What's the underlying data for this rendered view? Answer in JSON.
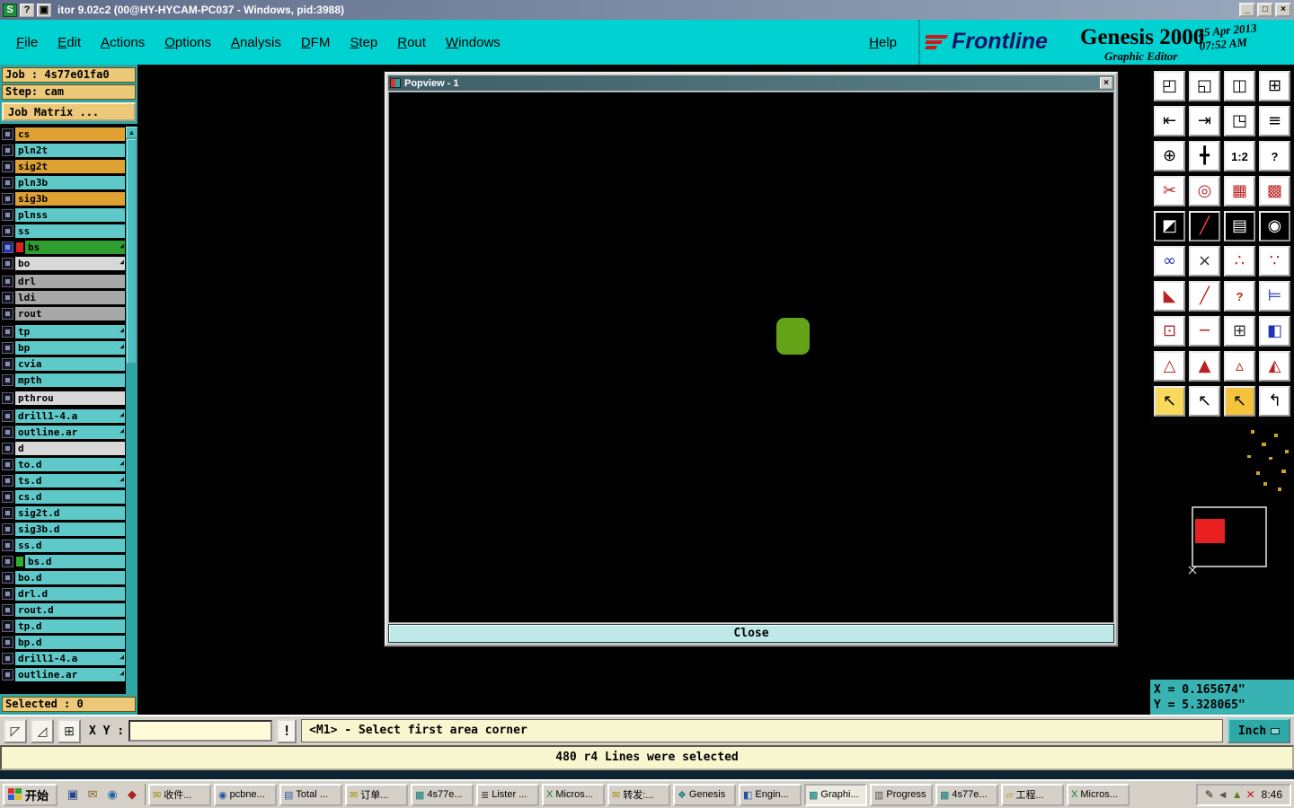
{
  "window": {
    "title": "itor 9.02c2 (00@HY-HYCAM-PC037 - Windows, pid:3988)",
    "logo_glyph": "S",
    "help_glyph": "?",
    "extra_glyph": "▣",
    "minimize_glyph": "_",
    "maximize_glyph": "□",
    "close_glyph": "×"
  },
  "menubar": {
    "items": [
      "File",
      "Edit",
      "Actions",
      "Options",
      "Analysis",
      "DFM",
      "Step",
      "Rout",
      "Windows"
    ],
    "help": "Help"
  },
  "brand": {
    "frontline": "Frontline",
    "product": "Genesis 2000",
    "date": "25 Apr 2013",
    "time": "07:52 AM",
    "subtitle": "Graphic Editor"
  },
  "sidebar": {
    "job_label": "Job : 4s77e01fa0",
    "step_label": "Step: cam",
    "matrix_button": "Job Matrix ...",
    "selected_label": "Selected : 0",
    "marker_glyph": "◢",
    "scroll_up_glyph": "▲",
    "colors": {
      "orange": "#dfa232",
      "cyan": "#5fc9c9",
      "green": "#2f9e2f",
      "gray": "#a8a8a8",
      "light": "#d8d8d8"
    },
    "layers": [
      {
        "name": "cs",
        "color": "#dfa232"
      },
      {
        "name": "pln2t",
        "color": "#5fc9c9"
      },
      {
        "name": "sig2t",
        "color": "#dfa232"
      },
      {
        "name": "pln3b",
        "color": "#5fc9c9"
      },
      {
        "name": "sig3b",
        "color": "#dfa232"
      },
      {
        "name": "plnss",
        "color": "#5fc9c9"
      },
      {
        "name": "ss",
        "color": "#5fc9c9"
      },
      {
        "name": "bs",
        "color": "#2f9e2f",
        "checkbox": "#2233bb",
        "swatch": "#dd2222",
        "marker": true
      },
      {
        "name": "bo",
        "color": "#d8d8d8",
        "marker": true
      },
      {
        "name": "drl",
        "color": "#a8a8a8",
        "gap": true
      },
      {
        "name": "ldi",
        "color": "#a8a8a8"
      },
      {
        "name": "rout",
        "color": "#a8a8a8"
      },
      {
        "name": "tp",
        "color": "#5fc9c9",
        "marker": true,
        "gap": true
      },
      {
        "name": "bp",
        "color": "#5fc9c9",
        "marker": true
      },
      {
        "name": "cvia",
        "color": "#5fc9c9"
      },
      {
        "name": "mpth",
        "color": "#5fc9c9"
      },
      {
        "name": "pthrou",
        "color": "#d8d8d8",
        "gap": true
      },
      {
        "name": "drill1-4.a",
        "color": "#5fc9c9",
        "marker": true,
        "gap": true
      },
      {
        "name": "outline.ar",
        "color": "#5fc9c9",
        "marker": true
      },
      {
        "name": "d",
        "color": "#d8d8d8"
      },
      {
        "name": "to.d",
        "color": "#5fc9c9",
        "marker": true
      },
      {
        "name": "ts.d",
        "color": "#5fc9c9",
        "marker": true
      },
      {
        "name": "cs.d",
        "color": "#5fc9c9"
      },
      {
        "name": "sig2t.d",
        "color": "#5fc9c9"
      },
      {
        "name": "sig3b.d",
        "color": "#5fc9c9"
      },
      {
        "name": "ss.d",
        "color": "#5fc9c9"
      },
      {
        "name": "bs.d",
        "color": "#5fc9c9",
        "swatch": "#2fae2f"
      },
      {
        "name": "bo.d",
        "color": "#5fc9c9"
      },
      {
        "name": "drl.d",
        "color": "#5fc9c9"
      },
      {
        "name": "rout.d",
        "color": "#5fc9c9"
      },
      {
        "name": "tp.d",
        "color": "#5fc9c9"
      },
      {
        "name": "bp.d",
        "color": "#5fc9c9"
      },
      {
        "name": "drill1-4.a",
        "color": "#5fc9c9",
        "marker": true
      },
      {
        "name": "outline.ar",
        "color": "#5fc9c9",
        "marker": true
      }
    ]
  },
  "popview": {
    "title": "Popview - 1",
    "close_button": "Close",
    "close_glyph": "×",
    "pad_color": "#64a318"
  },
  "tools": [
    {
      "name": "fit-screen-tool",
      "glyph": "◰",
      "bg": "#ffffff",
      "fg": "#000000"
    },
    {
      "name": "redraw-screen-tool",
      "glyph": "◱",
      "bg": "#ffffff",
      "fg": "#000000"
    },
    {
      "name": "dual-view-tool",
      "glyph": "◫",
      "bg": "#ffffff",
      "fg": "#000000"
    },
    {
      "name": "quad-view-tool",
      "glyph": "⊞",
      "bg": "#ffffff",
      "fg": "#000000"
    },
    {
      "name": "pan-left-tool",
      "glyph": "⇤",
      "bg": "#ffffff",
      "fg": "#000000"
    },
    {
      "name": "pan-right-tool",
      "glyph": "⇥",
      "bg": "#ffffff",
      "fg": "#000000"
    },
    {
      "name": "previous-view-tool",
      "glyph": "◳",
      "bg": "#ffffff",
      "fg": "#000000"
    },
    {
      "name": "layer-stack-tool",
      "glyph": "≡",
      "bg": "#ffffff",
      "fg": "#000000"
    },
    {
      "name": "zoom-center-tool",
      "glyph": "⊕",
      "bg": "#ffffff",
      "fg": "#000000"
    },
    {
      "name": "pan-tool",
      "glyph": "╋",
      "bg": "#ffffff",
      "fg": "#000000"
    },
    {
      "name": "zoom-ratio-tool",
      "glyph": "1:2",
      "bg": "#ffffff",
      "fg": "#000000",
      "text": true
    },
    {
      "name": "help-tool",
      "glyph": "?",
      "bg": "#ffffff",
      "fg": "#000000",
      "text": true
    },
    {
      "name": "copy-view-tool",
      "glyph": "✂",
      "bg": "#ffffff",
      "fg": "#bb2222"
    },
    {
      "name": "probe-tool",
      "glyph": "◎",
      "bg": "#ffffff",
      "fg": "#bb2222"
    },
    {
      "name": "grid-snap-tool",
      "glyph": "▦",
      "bg": "#ffffff",
      "fg": "#bb2222"
    },
    {
      "name": "dot-grid-tool",
      "glyph": "▩",
      "bg": "#ffffff",
      "fg": "#bb2222"
    },
    {
      "name": "origin-tool",
      "glyph": "◩",
      "bg": "#000000",
      "fg": "#ffffff"
    },
    {
      "name": "diagonal-measure-tool",
      "glyph": "╱",
      "bg": "#000000",
      "fg": "#ff4444"
    },
    {
      "name": "ruler-tool",
      "glyph": "▤",
      "bg": "#000000",
      "fg": "#ffffff"
    },
    {
      "name": "center-mark-tool",
      "glyph": "◉",
      "bg": "#000000",
      "fg": "#ffffff"
    },
    {
      "name": "connect-points-tool",
      "glyph": "∞",
      "bg": "#ffffff",
      "fg": "#2233bb"
    },
    {
      "name": "close-pair-tool",
      "glyph": "×",
      "bg": "#ffffff",
      "fg": "#333333"
    },
    {
      "name": "measure-pair-tool",
      "glyph": "∴",
      "bg": "#ffffff",
      "fg": "#bb2222"
    },
    {
      "name": "measure-pad-tool",
      "glyph": "∵",
      "bg": "#ffffff",
      "fg": "#bb2222"
    },
    {
      "name": "angle-measure-tool",
      "glyph": "◣",
      "bg": "#ffffff",
      "fg": "#bb2222"
    },
    {
      "name": "slope-measure-tool",
      "glyph": "╱",
      "bg": "#ffffff",
      "fg": "#bb2222"
    },
    {
      "name": "query-tool",
      "glyph": "?",
      "bg": "#ffffff",
      "fg": "#bb2222",
      "text": true
    },
    {
      "name": "net-compare-tool",
      "glyph": "⊨",
      "bg": "#ffffff",
      "fg": "#2233bb"
    },
    {
      "name": "pad-mark-tool",
      "glyph": "⊡",
      "bg": "#ffffff",
      "fg": "#bb2222"
    },
    {
      "name": "line-mark-tool",
      "glyph": "─",
      "bg": "#ffffff",
      "fg": "#bb2222"
    },
    {
      "name": "frame-snap-tool",
      "glyph": "⊞",
      "bg": "#ffffff",
      "fg": "#333333"
    },
    {
      "name": "fill-area-tool",
      "glyph": "◧",
      "bg": "#ffffff",
      "fg": "#2233bb"
    },
    {
      "name": "triangle-open-tool",
      "glyph": "△",
      "bg": "#ffffff",
      "fg": "#bb2222"
    },
    {
      "name": "triangle-filled-tool",
      "glyph": "▲",
      "bg": "#ffffff",
      "fg": "#bb2222"
    },
    {
      "name": "triangle-small-tool",
      "glyph": "▵",
      "bg": "#ffffff",
      "fg": "#bb2222"
    },
    {
      "name": "triangle-mixed-tool",
      "glyph": "◭",
      "bg": "#ffffff",
      "fg": "#bb2222"
    },
    {
      "name": "select-cursor-tool",
      "glyph": "↖",
      "bg": "#f7d95c",
      "fg": "#000000"
    },
    {
      "name": "select-window-tool",
      "glyph": "↖",
      "bg": "#ffffff",
      "fg": "#000000"
    },
    {
      "name": "select-yellow-tool",
      "glyph": "↖",
      "bg": "#f5c23c",
      "fg": "#000000"
    },
    {
      "name": "select-route-tool",
      "glyph": "↰",
      "bg": "#ffffff",
      "fg": "#000000"
    }
  ],
  "statusbar": {
    "buttons": [
      {
        "name": "area-select-button",
        "glyph": "◸"
      },
      {
        "name": "area-select-alt-button",
        "glyph": "◿"
      },
      {
        "name": "grid-button",
        "glyph": "⊞"
      }
    ],
    "xy_label": "X Y :",
    "xy_value": "",
    "alert_button": "!",
    "message": "<M1> - Select first area corner",
    "units_button": "Inch"
  },
  "noticebar": {
    "message": "480 r4 Lines were selected"
  },
  "coords": {
    "x": "X = 0.165674\"",
    "y": "Y = 5.328065\""
  },
  "taskbar": {
    "start_label": "开始",
    "quick_launch": [
      {
        "name": "desktop-icon",
        "glyph": "▣",
        "color": "#224488"
      },
      {
        "name": "mail-icon",
        "glyph": "✉",
        "color": "#886622"
      },
      {
        "name": "browser-icon",
        "glyph": "◉",
        "color": "#2266aa"
      },
      {
        "name": "media-icon",
        "glyph": "◆",
        "color": "#aa2222"
      }
    ],
    "items": [
      {
        "label": "收件...",
        "icon": "mail-icon",
        "glyph": "✉",
        "color": "#aa8800"
      },
      {
        "label": "pcbne...",
        "icon": "app-icon",
        "glyph": "◉",
        "color": "#2255aa"
      },
      {
        "label": "Total ...",
        "icon": "disk-icon",
        "glyph": "▤",
        "color": "#3355aa"
      },
      {
        "label": "订单...",
        "icon": "mail-icon",
        "glyph": "✉",
        "color": "#aa8800"
      },
      {
        "label": "4s77e...",
        "icon": "editor-icon",
        "glyph": "▦",
        "color": "#117777"
      },
      {
        "label": "Lister ...",
        "icon": "list-icon",
        "glyph": "≣",
        "color": "#444444"
      },
      {
        "label": "Micros...",
        "icon": "excel-icon",
        "glyph": "X",
        "color": "#117733"
      },
      {
        "label": "转发:...",
        "icon": "mail-icon",
        "glyph": "✉",
        "color": "#aa8800"
      },
      {
        "label": "Genesis",
        "icon": "genesis-icon",
        "glyph": "❖",
        "color": "#0b7a7a"
      },
      {
        "label": "Engin...",
        "icon": "app-icon",
        "glyph": "◧",
        "color": "#2255aa"
      },
      {
        "label": "Graphi...",
        "icon": "genesis-icon",
        "glyph": "▩",
        "color": "#0b7a7a",
        "active": true
      },
      {
        "label": "Progress",
        "icon": "progress-icon",
        "glyph": "▥",
        "color": "#555555"
      },
      {
        "label": "4s77e...",
        "icon": "editor-icon",
        "glyph": "▦",
        "color": "#117777"
      },
      {
        "label": "工程...",
        "icon": "folder-icon",
        "glyph": "▱",
        "color": "#bb8800"
      },
      {
        "label": "Micros...",
        "icon": "excel-icon",
        "glyph": "X",
        "color": "#117733"
      }
    ],
    "tray_icons": [
      {
        "name": "pen-icon",
        "glyph": "✎",
        "color": "#222222"
      },
      {
        "name": "volume-icon",
        "glyph": "◄",
        "color": "#555555"
      },
      {
        "name": "antivirus-icon",
        "glyph": "▲",
        "color": "#667722"
      },
      {
        "name": "error-icon",
        "glyph": "✕",
        "color": "#cc1111"
      }
    ],
    "clock": "8:46"
  }
}
